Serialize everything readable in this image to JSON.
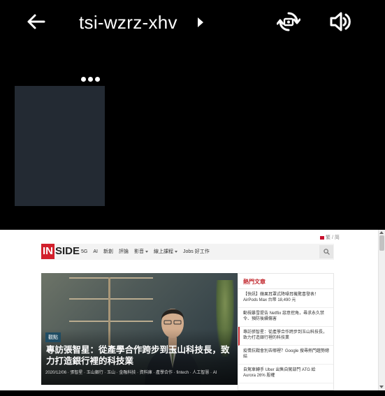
{
  "topbar": {
    "back_icon": "arrow-left-icon",
    "title": "tsi-wzrz-xhv",
    "chevron_icon": "chevron-right-icon",
    "switch_camera_icon": "switch-camera-icon",
    "speaker_icon": "speaker-icon"
  },
  "self_view": {
    "more_icon": "more-horizontal-icon"
  },
  "shared_screen": {
    "lang": "繁 / 简",
    "logo": {
      "in": "IN",
      "side": "SIDE"
    },
    "nav": [
      "5G",
      "AI",
      "新創",
      "評論",
      "影音",
      "線上課程",
      "Jobs 好工作"
    ],
    "nav_dropdowns": [
      "影音",
      "線上課程"
    ],
    "hero": {
      "tag": "觀點",
      "title": "專訪張智星：從產學合作跨步到玉山科技長，致力打造銀行裡的科技業",
      "meta": "2020/12/06 · 張智星 · 玉山銀行 · 玉山 · 金融科技 · 資料庫 · 產學合作 · fintech · 人工智慧 · AI"
    },
    "sidebar": {
      "heading": "熱門文章",
      "items": [
        "【快訊】蘋果耳罩式降噪耳機驚喜發表！AirPods Max 台幣 18,490 元",
        "動視暴雪提告 Netflix 惡意挖角，尋求永久禁令、預防後續傷害",
        "專訪張智星：從產學合作跨步到玉山科技長，致力打造銀行裡的科技業",
        "疫情抗戰會別去哪裡？Google 搜尋熱門趨勢總結",
        "自駕車轉手 Uber 出售自駕部門 ATG 給 Aurora 26% 股權"
      ]
    }
  },
  "colors": {
    "background": "#000000",
    "self_tile": "#232a33",
    "inside_red": "#d2202c"
  }
}
